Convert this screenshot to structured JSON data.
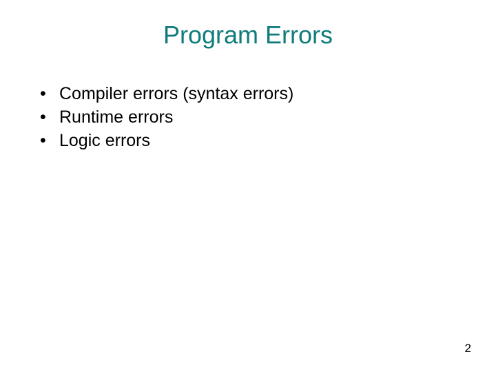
{
  "slide": {
    "title": "Program Errors",
    "bullets": [
      "Compiler errors (syntax errors)",
      "Runtime errors",
      "Logic errors"
    ],
    "page_number": "2"
  }
}
